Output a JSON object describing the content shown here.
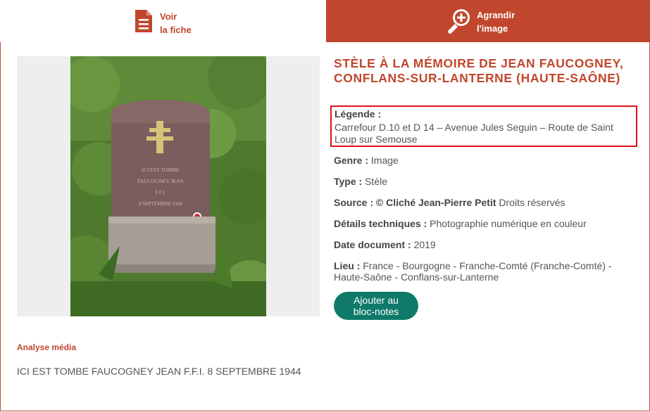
{
  "tabs": {
    "view_record": {
      "line1": "Voir",
      "line2": "la fiche",
      "icon": "document-icon"
    },
    "enlarge_image": {
      "line1": "Agrandir",
      "line2": "l'image",
      "icon": "zoom-in-icon"
    }
  },
  "record": {
    "title": "STÈLE À LA MÉMOIRE DE JEAN FAUCOGNEY, CONFLANS-SUR-LANTERNE (HAUTE-SAÔNE)",
    "legend_label": "Légende :",
    "legend_text": "Carrefour D.10 et D 14 – Avenue Jules Seguin – Route de Saint Loup sur Semouse",
    "genre_label": "Genre :",
    "genre_value": "Image",
    "type_label": "Type :",
    "type_value": "Stèle",
    "source_label": "Source : © Cliché Jean-Pierre Petit",
    "source_value": "Droits réservés",
    "details_label": "Détails techniques :",
    "details_value": "Photographie numérique en couleur",
    "date_label": "Date document :",
    "date_value": "2019",
    "place_label": "Lieu :",
    "place_value": "France - Bourgogne - Franche-Comté (Franche-Comté) - Haute-Saône - Conflans-sur-Lanterne",
    "notepad_button": "Ajouter au bloc-notes"
  },
  "photo": {
    "stele_inscription": "ICI EST TOMBE FAUCOGNEY JEAN F.F.I. 8 SEPTEMBRE 1944"
  },
  "analysis": {
    "heading": "Analyse média",
    "text": "ICI EST TOMBE FAUCOGNEY JEAN F.F.I. 8 SEPTEMBRE 1944"
  },
  "colors": {
    "accent": "#c0472d",
    "button": "#107a6a",
    "highlight": "#e0101a"
  }
}
